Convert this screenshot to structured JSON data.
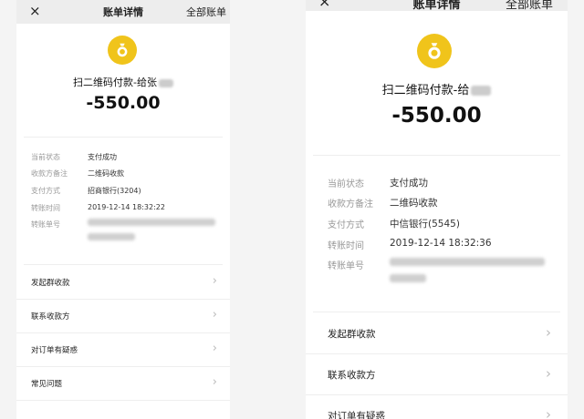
{
  "screens": [
    {
      "header": {
        "close_glyph": "×",
        "title": "账单详情",
        "all_bills": "全部账单"
      },
      "icon": "money-bag-icon",
      "payee_text": "扫二维码付款-给张",
      "amount": "-550.00",
      "fields": [
        {
          "label": "当前状态",
          "value": "支付成功"
        },
        {
          "label": "收款方备注",
          "value": "二维码收款"
        },
        {
          "label": "支付方式",
          "value": "招商银行(3204)"
        },
        {
          "label": "转账时间",
          "value": "2019-12-14 18:32:22"
        },
        {
          "label": "转账单号",
          "value": ""
        }
      ],
      "actions": [
        "发起群收款",
        "联系收款方",
        "对订单有疑惑",
        "常见问题"
      ],
      "chevron_glyph": "›"
    },
    {
      "header": {
        "close_glyph": "×",
        "title": "账单详情",
        "all_bills": "全部账单"
      },
      "icon": "money-bag-icon",
      "payee_text": "扫二维码付款-给",
      "amount": "-550.00",
      "fields": [
        {
          "label": "当前状态",
          "value": "支付成功"
        },
        {
          "label": "收款方备注",
          "value": "二维码收款"
        },
        {
          "label": "支付方式",
          "value": "中信银行(5545)"
        },
        {
          "label": "转账时间",
          "value": "2019-12-14 18:32:36"
        },
        {
          "label": "转账单号",
          "value": ""
        }
      ],
      "actions": [
        "发起群收款",
        "联系收款方",
        "对订单有疑惑"
      ],
      "chevron_glyph": "›"
    }
  ],
  "colors": {
    "icon_gold": "#f0c41b",
    "header_bg": "#ededed",
    "muted_label": "#999999"
  }
}
